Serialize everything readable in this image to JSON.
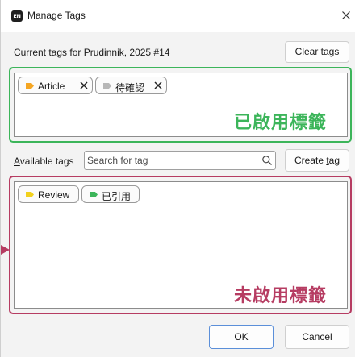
{
  "window": {
    "app_icon_text": "EN",
    "title": "Manage Tags",
    "close_icon": "close-icon"
  },
  "current": {
    "label": "Current tags for Prudinnik, 2025 #14",
    "clear_button": {
      "prefix": "",
      "mnemonic": "C",
      "suffix": "lear tags"
    },
    "tags": [
      {
        "label": "Article",
        "color": "#f5a623"
      },
      {
        "label": "待確認",
        "color": "#b7b7b7"
      }
    ],
    "annotation": "已啟用標籤"
  },
  "available": {
    "label_mnemonic": "A",
    "label_rest": "vailable tags",
    "search": {
      "placeholder": "Search for tag",
      "value": ""
    },
    "create_button": {
      "prefix": "Create ",
      "mnemonic": "t",
      "suffix": "ag"
    },
    "tags": [
      {
        "label": "Review",
        "color": "#f2d11e"
      },
      {
        "label": "已引用",
        "color": "#3cb55a"
      }
    ],
    "annotation": "未啟用標籤"
  },
  "footer": {
    "ok_label": "OK",
    "cancel_label": "Cancel"
  },
  "colors": {
    "highlight_green": "#3cb55a",
    "highlight_red": "#b63c62",
    "ok_border": "#5b8fd9"
  }
}
